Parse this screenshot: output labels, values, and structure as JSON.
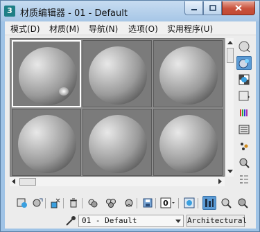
{
  "window": {
    "app_icon_text": "3",
    "title": "材质编辑器 - 01 - Default"
  },
  "menubar": {
    "items": [
      {
        "label": "模式(D)"
      },
      {
        "label": "材质(M)"
      },
      {
        "label": "导航(N)"
      },
      {
        "label": "选项(O)"
      },
      {
        "label": "实用程序(U)"
      }
    ]
  },
  "sample_slots": {
    "rows": 2,
    "cols": 3,
    "active_slot": 1
  },
  "side_toolbar": {
    "icons": [
      "sample-type-icon",
      "backlight-icon",
      "background-icon",
      "sample-uv-tiling-icon",
      "video-color-check-icon",
      "make-preview-icon",
      "options-icon",
      "select-by-material-icon",
      "material-map-navigator-icon"
    ]
  },
  "bottom_toolbar": {
    "icons": [
      "get-material-icon",
      "put-to-scene-icon",
      "assign-to-selection-icon",
      "reset-map-icon",
      "make-unique-icon",
      "copy-material-icon",
      "put-to-library-icon",
      "material-id-channel-icon",
      "show-map-in-viewport-icon",
      "show-end-result-icon",
      "go-to-parent-icon",
      "go-forward-icon"
    ],
    "material_id_channel": "0"
  },
  "footer": {
    "material_name": "01 - Default",
    "material_type": "Architectural"
  },
  "colors": {
    "title_gradient_top": "#c7dcf1",
    "active_tool": "#5b9bd5",
    "close_button": "#c8513c"
  }
}
